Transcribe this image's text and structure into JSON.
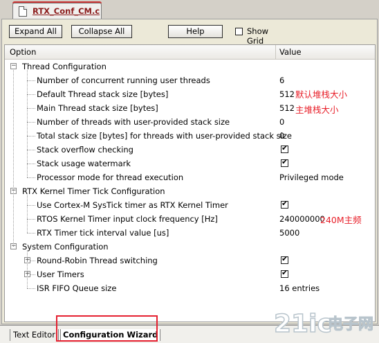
{
  "file_tab": {
    "title": "RTX_Conf_CM.c",
    "icon": "c-file-icon"
  },
  "toolbar": {
    "expand_all": "Expand All",
    "collapse_all": "Collapse All",
    "help": "Help",
    "show_grid": "Show Grid",
    "show_grid_checked": false
  },
  "grid": {
    "col_option": "Option",
    "col_value": "Value"
  },
  "groups": [
    {
      "label": "Thread Configuration",
      "expander": "−"
    },
    {
      "label": "RTX Kernel Timer Tick Configuration",
      "expander": "−"
    },
    {
      "label": "System Configuration",
      "expander": "−"
    }
  ],
  "items": [
    {
      "label": "Number of concurrent running user threads",
      "value": "6"
    },
    {
      "label": "Default Thread stack size [bytes]",
      "value": "512",
      "note": "默认堆栈大小"
    },
    {
      "label": "Main Thread stack size [bytes]",
      "value": "512",
      "note": "主堆栈大小"
    },
    {
      "label": "Number of threads with user-provided stack size",
      "value": "0"
    },
    {
      "label": "Total stack size [bytes] for threads with user-provided stack size",
      "value": "0"
    },
    {
      "label": "Stack overflow checking",
      "checked": true
    },
    {
      "label": "Stack usage watermark",
      "checked": true
    },
    {
      "label": "Processor mode for thread execution",
      "value": "Privileged mode"
    },
    {
      "label": "Use Cortex-M SysTick timer as RTX Kernel Timer",
      "checked": true
    },
    {
      "label": "RTOS Kernel Timer input clock frequency [Hz]",
      "value": "240000000",
      "note": "240M主频"
    },
    {
      "label": "RTX Timer tick interval value [us]",
      "value": "5000"
    },
    {
      "label": "Round-Robin Thread switching",
      "checked": true,
      "expander": "+"
    },
    {
      "label": "User Timers",
      "checked": true,
      "expander": "+"
    },
    {
      "label": "ISR FIFO Queue size",
      "value": "16 entries"
    }
  ],
  "bottom_tabs": {
    "text_editor": "Text Editor",
    "config_wizard": "Configuration Wizard"
  },
  "watermark": {
    "text": "21ic电子网"
  },
  "colors": {
    "annotation": "#e8202a",
    "tab_accent": "#cc3333"
  }
}
